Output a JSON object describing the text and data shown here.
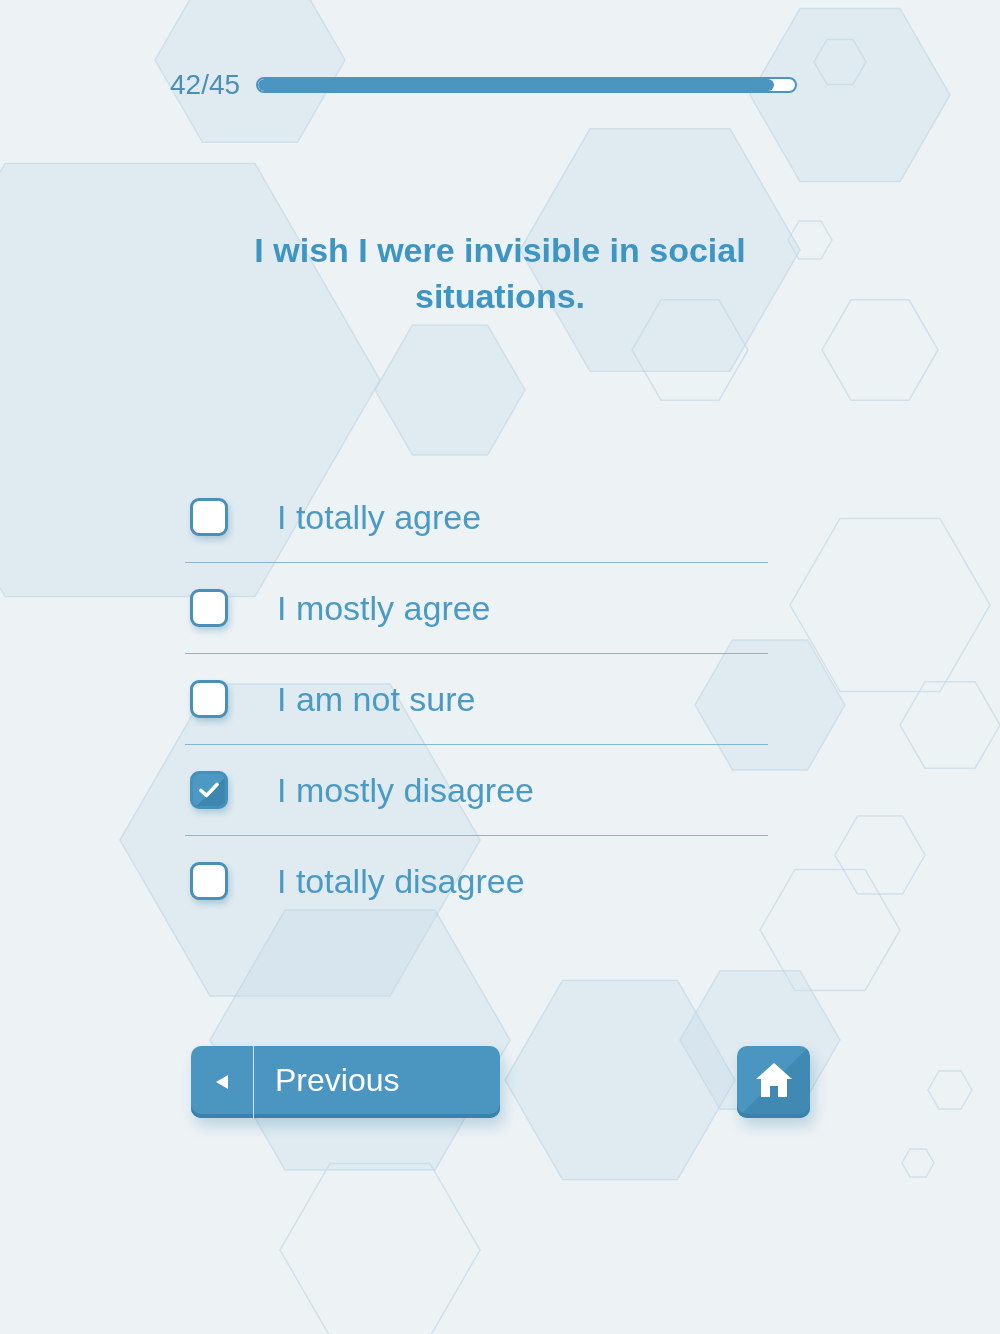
{
  "progress": {
    "counter": "42/45",
    "level": 0.96
  },
  "question": "I wish I were invisible in social situations.",
  "options": [
    {
      "label": "I totally agree",
      "checked": false
    },
    {
      "label": "I mostly agree",
      "checked": false
    },
    {
      "label": "I am not sure",
      "checked": false
    },
    {
      "label": "I mostly disagree",
      "checked": true
    },
    {
      "label": "I totally disagree",
      "checked": false
    }
  ],
  "previous_button": {
    "label": "Previous"
  }
}
